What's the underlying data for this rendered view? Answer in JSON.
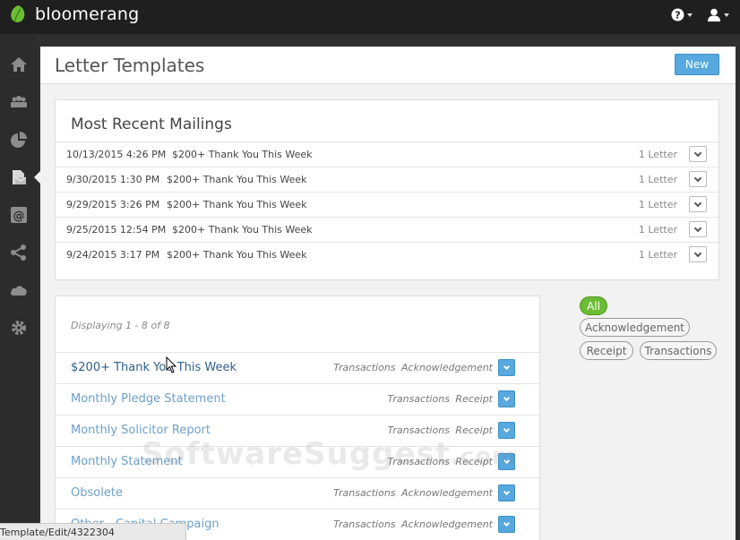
{
  "app": {
    "name": "bloomerang",
    "brand_color": "#6cbc34",
    "accent_color": "#56a8de"
  },
  "topbar": {
    "help_icon": "help-icon",
    "user_icon": "user-icon"
  },
  "sidebar": {
    "items": [
      {
        "icon": "home-icon"
      },
      {
        "icon": "constituents-icon"
      },
      {
        "icon": "reports-pie-icon"
      },
      {
        "icon": "letters-icon",
        "active": true
      },
      {
        "icon": "email-at-icon"
      },
      {
        "icon": "share-icon"
      },
      {
        "icon": "cloud-icon"
      },
      {
        "icon": "gear-icon"
      }
    ]
  },
  "page": {
    "title": "Letter Templates",
    "new_label": "New"
  },
  "mailings": {
    "title": "Most Recent Mailings",
    "rows": [
      {
        "date": "10/13/2015 4:26 PM",
        "name": "$200+ Thank You This Week",
        "count": "1 Letter"
      },
      {
        "date": "9/30/2015 1:30 PM",
        "name": "$200+ Thank You This Week",
        "count": "1 Letter"
      },
      {
        "date": "9/29/2015 3:26 PM",
        "name": "$200+ Thank You This Week",
        "count": "1 Letter"
      },
      {
        "date": "9/25/2015 12:54 PM",
        "name": "$200+ Thank You This Week",
        "count": "1 Letter"
      },
      {
        "date": "9/24/2015 3:17 PM",
        "name": "$200+ Thank You This Week",
        "count": "1 Letter"
      }
    ]
  },
  "templates": {
    "displaying": "Displaying 1 - 8 of 8",
    "rows": [
      {
        "name": "$200+ Thank You This Week",
        "tag1": "Transactions",
        "tag2": "Acknowledgement"
      },
      {
        "name": "Monthly Pledge Statement",
        "tag1": "Transactions",
        "tag2": "Receipt"
      },
      {
        "name": "Monthly Solicitor Report",
        "tag1": "Transactions",
        "tag2": "Receipt"
      },
      {
        "name": "Monthly Statement",
        "tag1": "Transactions",
        "tag2": "Receipt"
      },
      {
        "name": "Obsolete",
        "tag1": "Transactions",
        "tag2": "Acknowledgement"
      },
      {
        "name": "Other - Capital Campaign",
        "tag1": "Transactions",
        "tag2": "Acknowledgement"
      }
    ]
  },
  "filters": {
    "all": "All",
    "acknowledgement": "Acknowledgement",
    "receipt": "Receipt",
    "transactions": "Transactions"
  },
  "status_bar": {
    "url": "Template/Edit/4322304"
  },
  "watermark": {
    "main": "SoftwareSuggest",
    "suffix": ".com"
  }
}
